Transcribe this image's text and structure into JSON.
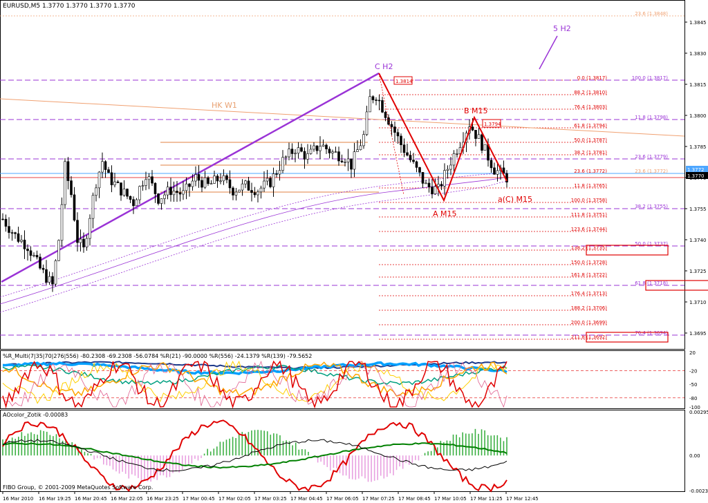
{
  "colors": {
    "background": "#ffffff",
    "candle": "#000000",
    "fib_red": "#e00000",
    "fib_purple": "#9a33d6",
    "fib_orange": "#f0a070",
    "trend_purple": "#9a33d6",
    "price_blue": "#4da6ff",
    "label_red": "#e00000",
    "label_orange": "#e8a070",
    "axis_text": "#000000"
  },
  "main": {
    "header": "EURUSD,M5  1.3770 1.3770 1.3770 1.3770",
    "ylim": [
      1.3688,
      1.3855
    ],
    "y_ticks": [
      "1.3845",
      "1.3830",
      "1.3815",
      "1.3800",
      "1.3785",
      "1.3770",
      "1.3755",
      "1.3740",
      "1.3725",
      "1.3710",
      "1.3695"
    ],
    "current_price_label": "1.3770",
    "blue_price_label": "1.3772",
    "wave_labels": {
      "c_h2": "C H2",
      "b_m15": "B M15",
      "a_m15": "A M15",
      "ac_m15": "a(C) M15",
      "hk_w1": "HK W1",
      "five_h2": "5 H2"
    },
    "price_boxes": [
      "1.3814",
      "1.3794"
    ],
    "fib_red_levels": [
      "0.0 (1.3817)",
      "88.2 (1.3810)",
      "76.4 (1.3803)",
      "61.8 (1.3794)",
      "50.0 (1.3787)",
      "38.2 (1.3781)",
      "23.6 (1.3772)",
      "11.8 (1.3765)",
      "100.0 (1.3758)",
      "111.8 (1.3751)",
      "123.6 (1.3744)",
      "138.2 (1.3735)",
      "150.0 (1.3728)",
      "161.8 (1.3722)",
      "176.4 (1.3713)",
      "188.2 (1.3706)",
      "200.0 (1.3699)",
      "211.8 (1.3692)"
    ],
    "fib_purple_levels": [
      "100.0 (1.3817)",
      "11.8 (1.3798)",
      "23.6 (1.3779)",
      "38.2 (1.3755)",
      "50.0 (1.3737)",
      "61.8 (1.3718)",
      "76.4 (1.3694)"
    ],
    "fib_orange_levels": [
      "23.6 (1.3848)",
      "23.6 (1.3772)"
    ]
  },
  "indicator1": {
    "header": "%R_Multi(7|35|70|276|556) -80.2308 -69.2308 -56.0784 %R(21) -90.0000 %R(556) -24.1379 %R(139) -79.5652",
    "y_ticks": [
      "20",
      "-20",
      "-50",
      "-80",
      "-100"
    ]
  },
  "indicator2": {
    "header": "AOcolor_Zotik -0.00083",
    "y_ticks": [
      "0.00295",
      "0.00",
      "-0.00237"
    ],
    "copyright": "FIBO Group, © 2001-2009 MetaQuotes Software Corp."
  },
  "x_ticks": [
    "16 Mar 2010",
    "16 Mar 19:25",
    "16 Mar 20:45",
    "16 Mar 22:05",
    "16 Mar 23:25",
    "17 Mar 00:45",
    "17 Mar 02:05",
    "17 Mar 03:25",
    "17 Mar 04:45",
    "17 Mar 06:05",
    "17 Mar 07:25",
    "17 Mar 08:45",
    "17 Mar 10:05",
    "17 Mar 11:25",
    "17 Mar 12:45"
  ],
  "chart_data": {
    "type": "candlestick",
    "symbol": "EURUSD",
    "timeframe": "M5",
    "ylim": [
      1.3688,
      1.3855
    ],
    "price_path": [
      [
        0,
        1.375
      ],
      [
        4,
        1.3742
      ],
      [
        8,
        1.3737
      ],
      [
        12,
        1.3726
      ],
      [
        16,
        1.3718
      ],
      [
        18,
        1.374
      ],
      [
        20,
        1.3775
      ],
      [
        22,
        1.3762
      ],
      [
        24,
        1.374
      ],
      [
        26,
        1.3735
      ],
      [
        28,
        1.3752
      ],
      [
        30,
        1.3768
      ],
      [
        32,
        1.3778
      ],
      [
        34,
        1.377
      ],
      [
        38,
        1.3764
      ],
      [
        42,
        1.3758
      ],
      [
        46,
        1.3772
      ],
      [
        50,
        1.376
      ],
      [
        54,
        1.3764
      ],
      [
        58,
        1.3762
      ],
      [
        62,
        1.377
      ],
      [
        66,
        1.3766
      ],
      [
        70,
        1.377
      ],
      [
        74,
        1.3764
      ],
      [
        78,
        1.3766
      ],
      [
        82,
        1.3764
      ],
      [
        86,
        1.3768
      ],
      [
        90,
        1.3778
      ],
      [
        94,
        1.3784
      ],
      [
        98,
        1.378
      ],
      [
        102,
        1.3786
      ],
      [
        106,
        1.3782
      ],
      [
        110,
        1.378
      ],
      [
        112,
        1.3776
      ],
      [
        116,
        1.379
      ],
      [
        118,
        1.3808
      ],
      [
        120,
        1.381
      ],
      [
        124,
        1.3798
      ],
      [
        128,
        1.3786
      ],
      [
        132,
        1.3776
      ],
      [
        136,
        1.3766
      ],
      [
        140,
        1.3764
      ],
      [
        144,
        1.3778
      ],
      [
        148,
        1.379
      ],
      [
        150,
        1.3796
      ],
      [
        154,
        1.3786
      ],
      [
        158,
        1.3774
      ],
      [
        162,
        1.377
      ]
    ]
  }
}
